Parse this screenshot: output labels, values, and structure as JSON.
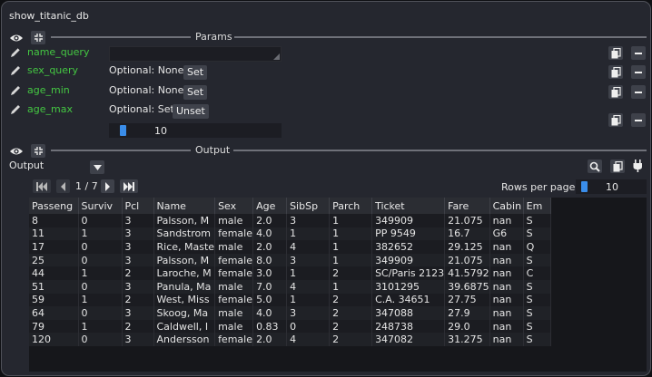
{
  "window": {
    "title": "show_titanic_db"
  },
  "params": {
    "section_label": "Params",
    "rows": [
      {
        "name": "name_query",
        "value": "",
        "state": "",
        "button": ""
      },
      {
        "name": "sex_query",
        "value": "",
        "state": "Optional: None",
        "button": "Set"
      },
      {
        "name": "age_min",
        "value": "",
        "state": "Optional: None",
        "button": "Set"
      },
      {
        "name": "age_max",
        "value": "10",
        "state": "Optional: Set",
        "button": "Unset"
      }
    ]
  },
  "output": {
    "section_label": "Output",
    "selector_value": "Output",
    "pagination": {
      "page_text": "1 / 7",
      "rows_per_page_label": "Rows per page:",
      "rows_per_page_value": "10"
    },
    "table": {
      "columns": [
        "Passeng",
        "Surviv",
        "Pcl",
        "Name",
        "Sex",
        "Age",
        "SibSp",
        "Parch",
        "Ticket",
        "Fare",
        "Cabin",
        "Em"
      ],
      "rows": [
        [
          "8",
          "0",
          "3",
          "Palsson, M",
          "male",
          "2.0",
          "3",
          "1",
          "349909",
          "21.075",
          "nan",
          "S"
        ],
        [
          "11",
          "1",
          "3",
          "Sandstrom",
          "female",
          "4.0",
          "1",
          "1",
          "PP 9549",
          "16.7",
          "G6",
          "S"
        ],
        [
          "17",
          "0",
          "3",
          "Rice, Maste",
          "male",
          "2.0",
          "4",
          "1",
          "382652",
          "29.125",
          "nan",
          "Q"
        ],
        [
          "25",
          "0",
          "3",
          "Palsson, M",
          "female",
          "8.0",
          "3",
          "1",
          "349909",
          "21.075",
          "nan",
          "S"
        ],
        [
          "44",
          "1",
          "2",
          "Laroche, M",
          "female",
          "3.0",
          "1",
          "2",
          "SC/Paris 2123",
          "41.5792",
          "nan",
          "C"
        ],
        [
          "51",
          "0",
          "3",
          "Panula, Ma",
          "male",
          "7.0",
          "4",
          "1",
          "3101295",
          "39.6875",
          "nan",
          "S"
        ],
        [
          "59",
          "1",
          "2",
          "West, Miss",
          "female",
          "5.0",
          "1",
          "2",
          "C.A. 34651",
          "27.75",
          "nan",
          "S"
        ],
        [
          "64",
          "0",
          "3",
          "Skoog, Ma",
          "male",
          "4.0",
          "3",
          "2",
          "347088",
          "27.9",
          "nan",
          "S"
        ],
        [
          "79",
          "1",
          "2",
          "Caldwell, I",
          "male",
          "0.83",
          "0",
          "2",
          "248738",
          "29.0",
          "nan",
          "S"
        ],
        [
          "120",
          "0",
          "3",
          "Andersson",
          "female",
          "2.0",
          "4",
          "2",
          "347082",
          "31.275",
          "nan",
          "S"
        ]
      ]
    }
  },
  "colors": {
    "accent": "#3a8de9",
    "param_name": "#44c742",
    "panel": "#25272f"
  }
}
